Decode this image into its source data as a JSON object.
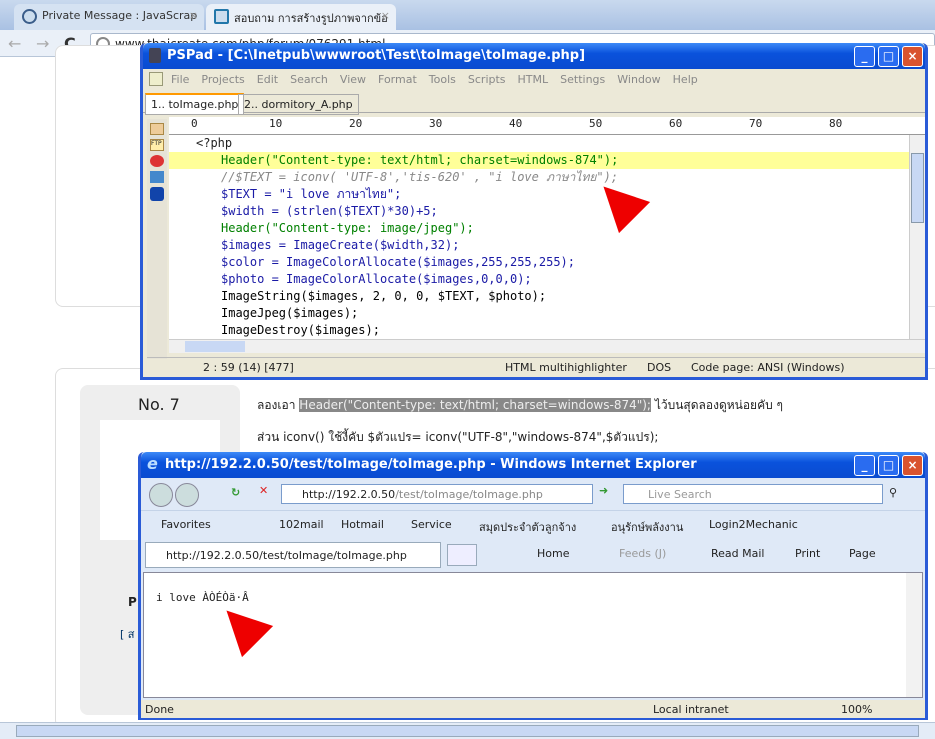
{
  "browser": {
    "tabs": [
      {
        "label": "Private Message : JavaScrap"
      },
      {
        "label": "สอบถาม การสร้างรูปภาพจากข้อ"
      }
    ],
    "url": "www.thaicreate.com/php/forum/076291.html"
  },
  "pspad": {
    "title": "PSPad - [C:\\Inetpub\\wwwroot\\Test\\toImage\\toImage.php]",
    "menu": [
      "File",
      "Projects",
      "Edit",
      "Search",
      "View",
      "Format",
      "Tools",
      "Scripts",
      "HTML",
      "Settings",
      "Window",
      "Help"
    ],
    "tabs": [
      "1.. toImage.php",
      "2.. dormitory_A.php"
    ],
    "ruler": [
      "0",
      "10",
      "20",
      "30",
      "40",
      "50",
      "60",
      "70",
      "80"
    ],
    "code": [
      "<?php",
      "Header(\"Content-type: text/html; charset=windows-874\");",
      "//$TEXT = iconv( 'UTF-8','tis-620' , \"i love ภาษาไทย\");",
      "$TEXT = \"i love ภาษาไทย\";",
      "$width = (strlen($TEXT)*30)+5;",
      "Header(\"Content-type: image/jpeg\");",
      "$images = ImageCreate($width,32);",
      "$color = ImageColorAllocate($images,255,255,255);",
      "$photo = ImageColorAllocate($images,0,0,0);",
      "ImageString($images, 2, 0, 0, $TEXT, $photo);",
      "ImageJpeg($images);",
      "ImageDestroy($images);"
    ],
    "status": {
      "pos": "2 : 59  (14)  [477]",
      "highlighter": "HTML multihighlighter",
      "eol": "DOS",
      "codepage": "Code page: ANSI (Windows)"
    }
  },
  "post": {
    "number": "No. 7",
    "line1_pre": "ลองเอา",
    "line1_code": "Header(\"Content-type: text/html; charset=windows-874\");",
    "line1_post": "ไว้บนสุดลองดูหน่อยคับ ๆ",
    "line2": "ส่วน iconv() ใช้งี้คับ $ตัวแปร= iconv(\"UTF-8\",\"windows-874\",$ตัวแปร);",
    "side_p": "P",
    "side_link": "[ ส"
  },
  "ie": {
    "title": "http://192.2.0.50/test/toImage/toImage.php - Windows Internet Explorer",
    "address_host": "http://192.2.0.50",
    "address_path": "/test/toImage/toImage.php",
    "search_placeholder": "Live Search",
    "favorites": [
      "Favorites",
      "102mail",
      "Hotmail",
      "Service",
      "สมุดประจำตัวลูกจ้าง",
      "อนุรักษ์พลังงาน",
      "Login2Mechanic"
    ],
    "tab": "http://192.2.0.50/test/toImage/toImage.php",
    "commands": [
      "Home",
      "Feeds (J)",
      "Read Mail",
      "Print",
      "Page"
    ],
    "content": "i love ÀÒÉÒä·Â",
    "status": {
      "left": "Done",
      "zone": "Local intranet",
      "zoom": "100%"
    }
  }
}
